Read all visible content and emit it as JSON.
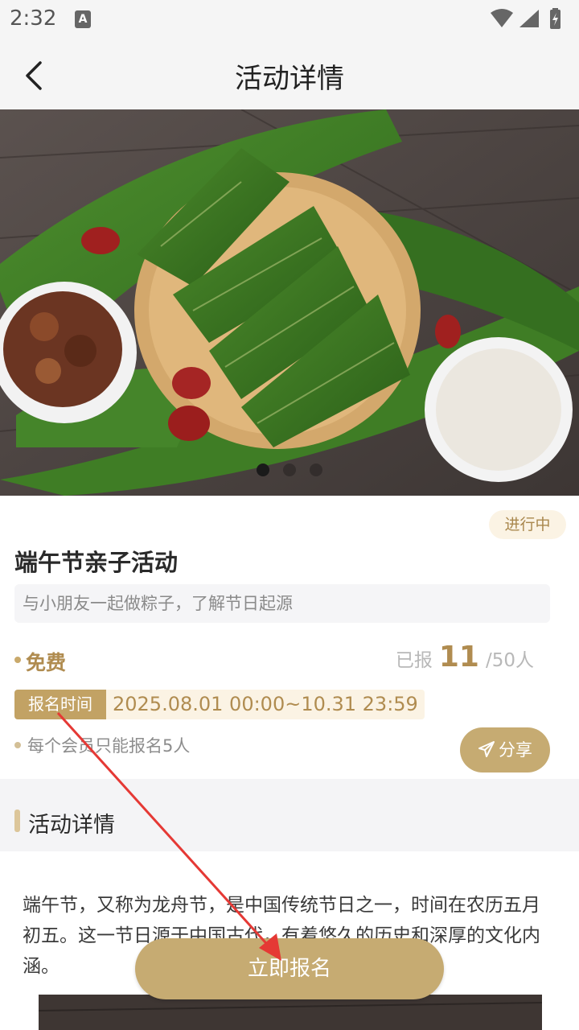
{
  "status_bar": {
    "time": "2:32",
    "notification_icon": "A"
  },
  "header": {
    "title": "活动详情",
    "back_icon": "chevron-left-icon"
  },
  "banner": {
    "slides_count": 3,
    "active_slide": 1
  },
  "activity": {
    "status": "进行中",
    "title": "端午节亲子活动",
    "subtitle": "与小朋友一起做粽子，了解节日起源",
    "price": "免费",
    "registered_label": "已报",
    "registered_count": "11",
    "capacity": "/50人",
    "time_label": "报名时间",
    "time_range": "2025.08.01 00:00~10.31 23:59",
    "limit_note": "每个会员只能报名5人",
    "share_label": "分享"
  },
  "details": {
    "section_title": "活动详情",
    "description": "端午节，又称为龙舟节，是中国传统节日之一，时间在农历五月初五。这一节日源于中国古代，有着悠久的历史和深厚的文化内涵。"
  },
  "signup_button": "立即报名",
  "colors": {
    "accent": "#c6ab72",
    "accent_text": "#b08c50",
    "badge_bg": "#fbf3e4",
    "annotation": "#e53935"
  }
}
